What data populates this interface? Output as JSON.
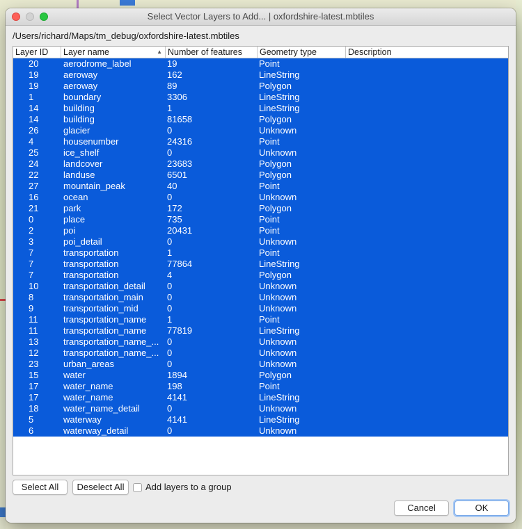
{
  "window": {
    "title": "Select Vector Layers to Add... | oxfordshire-latest.mbtiles",
    "path": "/Users/richard/Maps/tm_debug/oxfordshire-latest.mbtiles"
  },
  "table": {
    "columns": [
      "Layer ID",
      "Layer name",
      "Number of features",
      "Geometry type",
      "Description"
    ],
    "sort": {
      "column": "Layer name",
      "direction": "ascending"
    },
    "selection_color": "#0a5bda",
    "rows": [
      {
        "id": "20",
        "name": "aerodrome_label",
        "count": "19",
        "geom": "Point",
        "desc": ""
      },
      {
        "id": "19",
        "name": "aeroway",
        "count": "162",
        "geom": "LineString",
        "desc": ""
      },
      {
        "id": "19",
        "name": "aeroway",
        "count": "89",
        "geom": "Polygon",
        "desc": ""
      },
      {
        "id": "1",
        "name": "boundary",
        "count": "3306",
        "geom": "LineString",
        "desc": ""
      },
      {
        "id": "14",
        "name": "building",
        "count": "1",
        "geom": "LineString",
        "desc": ""
      },
      {
        "id": "14",
        "name": "building",
        "count": "81658",
        "geom": "Polygon",
        "desc": ""
      },
      {
        "id": "26",
        "name": "glacier",
        "count": "0",
        "geom": "Unknown",
        "desc": ""
      },
      {
        "id": "4",
        "name": "housenumber",
        "count": "24316",
        "geom": "Point",
        "desc": ""
      },
      {
        "id": "25",
        "name": "ice_shelf",
        "count": "0",
        "geom": "Unknown",
        "desc": ""
      },
      {
        "id": "24",
        "name": "landcover",
        "count": "23683",
        "geom": "Polygon",
        "desc": ""
      },
      {
        "id": "22",
        "name": "landuse",
        "count": "6501",
        "geom": "Polygon",
        "desc": ""
      },
      {
        "id": "27",
        "name": "mountain_peak",
        "count": "40",
        "geom": "Point",
        "desc": ""
      },
      {
        "id": "16",
        "name": "ocean",
        "count": "0",
        "geom": "Unknown",
        "desc": ""
      },
      {
        "id": "21",
        "name": "park",
        "count": "172",
        "geom": "Polygon",
        "desc": ""
      },
      {
        "id": "0",
        "name": "place",
        "count": "735",
        "geom": "Point",
        "desc": ""
      },
      {
        "id": "2",
        "name": "poi",
        "count": "20431",
        "geom": "Point",
        "desc": ""
      },
      {
        "id": "3",
        "name": "poi_detail",
        "count": "0",
        "geom": "Unknown",
        "desc": ""
      },
      {
        "id": "7",
        "name": "transportation",
        "count": "1",
        "geom": "Point",
        "desc": ""
      },
      {
        "id": "7",
        "name": "transportation",
        "count": "77864",
        "geom": "LineString",
        "desc": ""
      },
      {
        "id": "7",
        "name": "transportation",
        "count": "4",
        "geom": "Polygon",
        "desc": ""
      },
      {
        "id": "10",
        "name": "transportation_detail",
        "count": "0",
        "geom": "Unknown",
        "desc": ""
      },
      {
        "id": "8",
        "name": "transportation_main",
        "count": "0",
        "geom": "Unknown",
        "desc": ""
      },
      {
        "id": "9",
        "name": "transportation_mid",
        "count": "0",
        "geom": "Unknown",
        "desc": ""
      },
      {
        "id": "11",
        "name": "transportation_name",
        "count": "1",
        "geom": "Point",
        "desc": ""
      },
      {
        "id": "11",
        "name": "transportation_name",
        "count": "77819",
        "geom": "LineString",
        "desc": ""
      },
      {
        "id": "13",
        "name": "transportation_name_...",
        "count": "0",
        "geom": "Unknown",
        "desc": ""
      },
      {
        "id": "12",
        "name": "transportation_name_...",
        "count": "0",
        "geom": "Unknown",
        "desc": ""
      },
      {
        "id": "23",
        "name": "urban_areas",
        "count": "0",
        "geom": "Unknown",
        "desc": ""
      },
      {
        "id": "15",
        "name": "water",
        "count": "1894",
        "geom": "Polygon",
        "desc": ""
      },
      {
        "id": "17",
        "name": "water_name",
        "count": "198",
        "geom": "Point",
        "desc": ""
      },
      {
        "id": "17",
        "name": "water_name",
        "count": "4141",
        "geom": "LineString",
        "desc": ""
      },
      {
        "id": "18",
        "name": "water_name_detail",
        "count": "0",
        "geom": "Unknown",
        "desc": ""
      },
      {
        "id": "5",
        "name": "waterway",
        "count": "4141",
        "geom": "LineString",
        "desc": ""
      },
      {
        "id": "6",
        "name": "waterway_detail",
        "count": "0",
        "geom": "Unknown",
        "desc": ""
      }
    ]
  },
  "controls": {
    "select_all": "Select All",
    "deselect_all": "Deselect All",
    "group_checkbox_label": "Add layers to a group",
    "group_checkbox_checked": false,
    "cancel": "Cancel",
    "ok": "OK"
  }
}
